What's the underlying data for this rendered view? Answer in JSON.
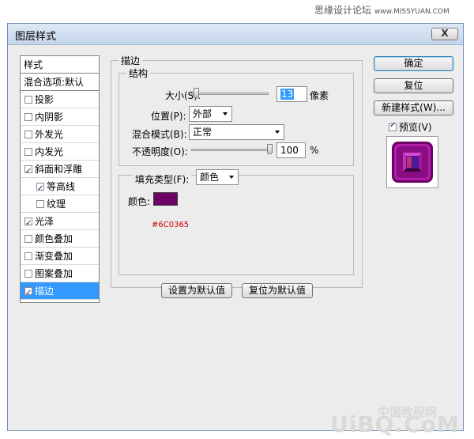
{
  "watermark": {
    "top_text": "思缘设计论坛",
    "top_url": "www.MISSYUAN.COM",
    "bottom_line1": "中国教程网",
    "bottom_logo": "UiBQ.CoM"
  },
  "window": {
    "title": "图层样式",
    "close_label": "X"
  },
  "style_list": {
    "header": "样式",
    "blend_options": "混合选项:默认",
    "items": [
      {
        "label": "投影",
        "checked": false,
        "indent": false,
        "selected": false
      },
      {
        "label": "内阴影",
        "checked": false,
        "indent": false,
        "selected": false
      },
      {
        "label": "外发光",
        "checked": false,
        "indent": false,
        "selected": false
      },
      {
        "label": "内发光",
        "checked": false,
        "indent": false,
        "selected": false
      },
      {
        "label": "斜面和浮雕",
        "checked": true,
        "indent": false,
        "selected": false
      },
      {
        "label": "等高线",
        "checked": true,
        "indent": true,
        "selected": false
      },
      {
        "label": "纹理",
        "checked": false,
        "indent": true,
        "selected": false
      },
      {
        "label": "光泽",
        "checked": true,
        "indent": false,
        "selected": false
      },
      {
        "label": "颜色叠加",
        "checked": false,
        "indent": false,
        "selected": false
      },
      {
        "label": "渐变叠加",
        "checked": false,
        "indent": false,
        "selected": false
      },
      {
        "label": "图案叠加",
        "checked": false,
        "indent": false,
        "selected": false
      },
      {
        "label": "描边",
        "checked": true,
        "indent": false,
        "selected": true
      }
    ]
  },
  "stroke": {
    "section_title": "描边",
    "structure_title": "结构",
    "size_label": "大小(S):",
    "size_value": "13",
    "size_unit": "像素",
    "size_fraction": 0.06,
    "position_label": "位置(P):",
    "position_value": "外部",
    "blend_label": "混合模式(B):",
    "blend_value": "正常",
    "opacity_label": "不透明度(O):",
    "opacity_value": "100",
    "opacity_unit": "%",
    "opacity_fraction": 1.0,
    "fill_type_label": "填充类型(F):",
    "fill_type_value": "颜色",
    "color_label": "颜色:",
    "color_hex": "#6C0365",
    "color_code_annotation": "#6C0365"
  },
  "buttons": {
    "set_default": "设置为默认值",
    "reset_default": "复位为默认值",
    "ok": "确定",
    "reset": "复位",
    "new_style": "新建样式(W)...",
    "preview_label": "预览(V)",
    "preview_checked": true
  },
  "colors": {
    "stroke_color": "#6c0365",
    "selection": "#3399ff",
    "annotation_red": "#cc0000"
  }
}
